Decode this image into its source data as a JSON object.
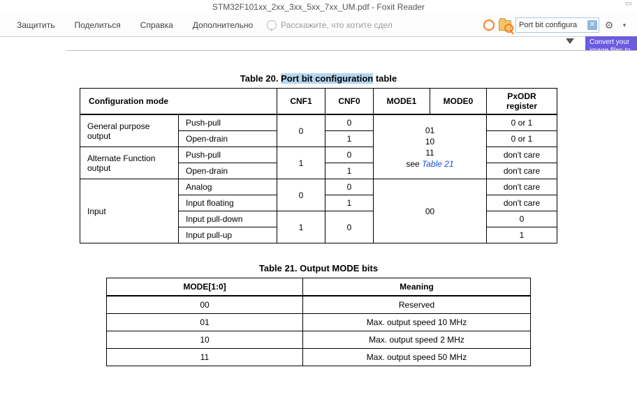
{
  "window": {
    "title": "STM32F101xx_2xx_3xx_5xx_7xx_UM.pdf - Foxit Reader"
  },
  "menu": {
    "protect": "Защитить",
    "share": "Поделиться",
    "help": "Справка",
    "extra": "Дополнительно",
    "tell_me": "Расскажите, что хотите сдел"
  },
  "search": {
    "query": "Port bit configura"
  },
  "banner": {
    "line1": "Convert your",
    "line2": "image files to"
  },
  "table20": {
    "caption_prefix": "Table 20. ",
    "caption_highlight": "Port bit configuration",
    "caption_suffix": " table",
    "headers": {
      "config_mode": "Configuration mode",
      "cnf1": "CNF1",
      "cnf0": "CNF0",
      "mode1": "MODE1",
      "mode0": "MODE0",
      "pxodr": "PxODR register"
    },
    "group1": {
      "label": "General purpose output",
      "row1": {
        "sub": "Push-pull",
        "cnf1": "0",
        "cnf0": "0",
        "px": "0 or 1"
      },
      "row2": {
        "sub": "Open-drain",
        "cnf0": "1",
        "px": "0 or 1"
      }
    },
    "group2": {
      "label": "Alternate Function output",
      "row1": {
        "sub": "Push-pull",
        "cnf1": "1",
        "cnf0": "0",
        "px": "don't care"
      },
      "row2": {
        "sub": "Open-drain",
        "cnf0": "1",
        "px": "don't care"
      }
    },
    "mode_cell": {
      "l1": "01",
      "l2": "10",
      "l3": "11",
      "l4a": "see ",
      "l4b": "Table 21"
    },
    "group3": {
      "label": "Input",
      "row1": {
        "sub": "Analog",
        "cnf1": "0",
        "cnf0": "0",
        "mode": "00",
        "px": "don't care"
      },
      "row2": {
        "sub": "Input floating",
        "cnf0": "1",
        "px": "don't care"
      },
      "row3": {
        "sub": "Input pull-down",
        "cnf1": "1",
        "cnf0": "0",
        "px": "0"
      },
      "row4": {
        "sub": "Input pull-up",
        "px": "1"
      }
    }
  },
  "table21": {
    "caption": "Table 21. Output MODE bits",
    "headers": {
      "mode": "MODE[1:0]",
      "meaning": "Meaning"
    },
    "rows": [
      {
        "mode": "00",
        "meaning": "Reserved"
      },
      {
        "mode": "01",
        "meaning": "Max. output speed 10 MHz"
      },
      {
        "mode": "10",
        "meaning": "Max. output speed 2 MHz"
      },
      {
        "mode": "11",
        "meaning": "Max. output speed 50 MHz"
      }
    ]
  }
}
